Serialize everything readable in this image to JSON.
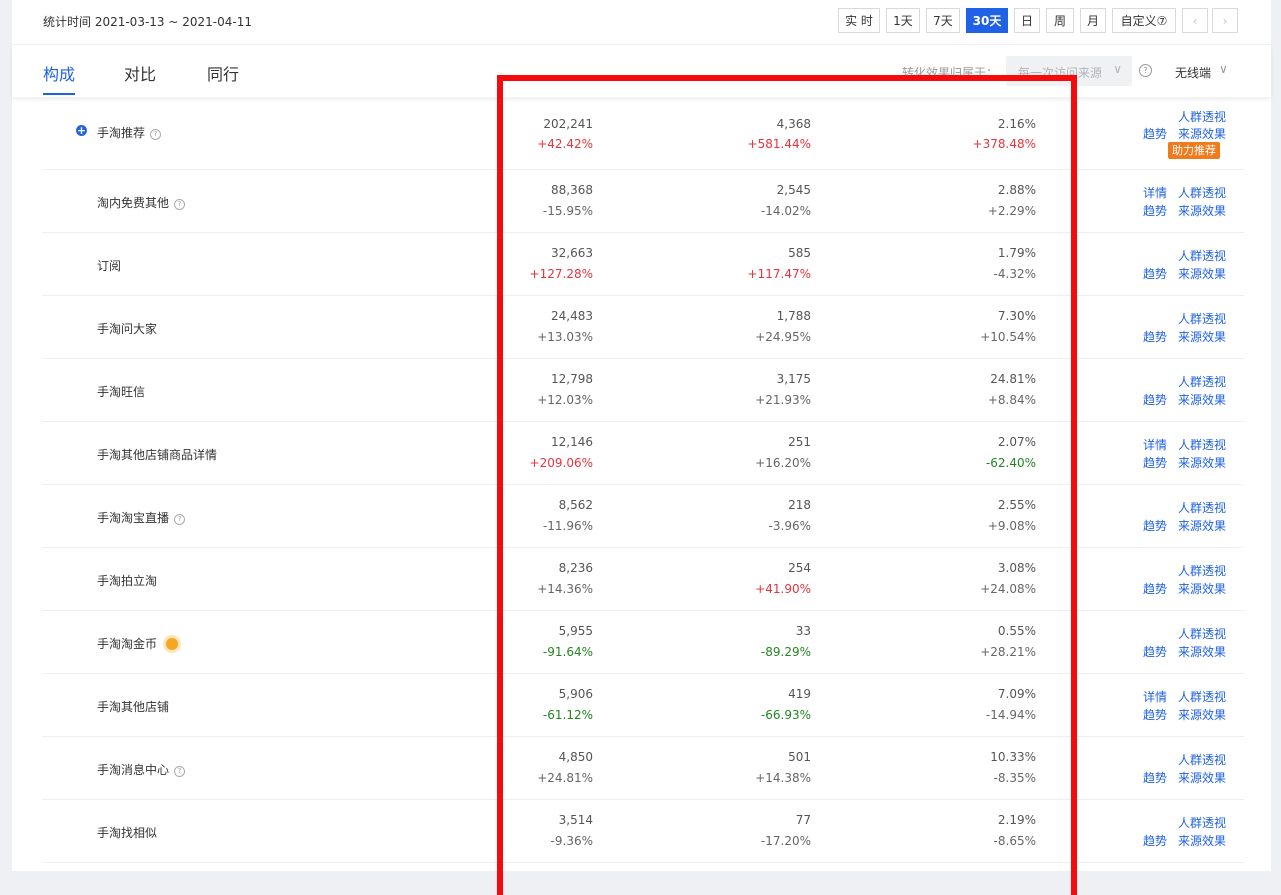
{
  "stat": {
    "label": "统计时间 2021-03-13 ~ 2021-04-11"
  },
  "range_buttons": [
    "实 时",
    "1天",
    "7天",
    "30天",
    "日",
    "周",
    "月",
    "自定义⑦"
  ],
  "tabs": [
    "构成",
    "对比",
    "同行"
  ],
  "filters": {
    "conversion_label": "转化效果归属于：",
    "source_value": "每一次访问来源",
    "device": "无线端"
  },
  "rows": [
    {
      "name": "手淘推荐",
      "help": true,
      "plus": true,
      "v1": "202,241",
      "c1": "+42.42%",
      "v2": "4,368",
      "c2": "+581.44%",
      "v3": "2.16%",
      "c3": "+378.48%",
      "links": [
        "人群透视",
        "趋势",
        "来源效果"
      ],
      "badge": "助力推荐"
    },
    {
      "name": "淘内免费其他",
      "help": true,
      "v1": "88,368",
      "c1": "-15.95%",
      "v2": "2,545",
      "c2": "-14.02%",
      "v3": "2.88%",
      "c3": "+2.29%",
      "links": [
        "详情",
        "人群透视",
        "趋势",
        "来源效果"
      ]
    },
    {
      "name": "订阅",
      "v1": "32,663",
      "c1": "+127.28%",
      "v2": "585",
      "c2": "+117.47%",
      "v3": "1.79%",
      "c3": "-4.32%",
      "links": [
        "人群透视",
        "趋势",
        "来源效果"
      ]
    },
    {
      "name": "手淘问大家",
      "v1": "24,483",
      "c1": "+13.03%",
      "v2": "1,788",
      "c2": "+24.95%",
      "v3": "7.30%",
      "c3": "+10.54%",
      "links": [
        "人群透视",
        "趋势",
        "来源效果"
      ]
    },
    {
      "name": "手淘旺信",
      "v1": "12,798",
      "c1": "+12.03%",
      "v2": "3,175",
      "c2": "+21.93%",
      "v3": "24.81%",
      "c3": "+8.84%",
      "links": [
        "人群透视",
        "趋势",
        "来源效果"
      ]
    },
    {
      "name": "手淘其他店铺商品详情",
      "v1": "12,146",
      "c1": "+209.06%",
      "v2": "251",
      "c2": "+16.20%",
      "v3": "2.07%",
      "c3": "-62.40%",
      "links": [
        "详情",
        "人群透视",
        "趋势",
        "来源效果"
      ]
    },
    {
      "name": "手淘淘宝直播",
      "help": true,
      "v1": "8,562",
      "c1": "-11.96%",
      "v2": "218",
      "c2": "-3.96%",
      "v3": "2.55%",
      "c3": "+9.08%",
      "links": [
        "人群透视",
        "趋势",
        "来源效果"
      ]
    },
    {
      "name": "手淘拍立淘",
      "v1": "8,236",
      "c1": "+14.36%",
      "v2": "254",
      "c2": "+41.90%",
      "v3": "3.08%",
      "c3": "+24.08%",
      "links": [
        "人群透视",
        "趋势",
        "来源效果"
      ]
    },
    {
      "name": "手淘淘金币",
      "coin": true,
      "v1": "5,955",
      "c1": "-91.64%",
      "v2": "33",
      "c2": "-89.29%",
      "v3": "0.55%",
      "c3": "+28.21%",
      "links": [
        "人群透视",
        "趋势",
        "来源效果"
      ]
    },
    {
      "name": "手淘其他店铺",
      "v1": "5,906",
      "c1": "-61.12%",
      "v2": "419",
      "c2": "-66.93%",
      "v3": "7.09%",
      "c3": "-14.94%",
      "links": [
        "详情",
        "人群透视",
        "趋势",
        "来源效果"
      ]
    },
    {
      "name": "手淘消息中心",
      "help": true,
      "v1": "4,850",
      "c1": "+24.81%",
      "v2": "501",
      "c2": "+14.38%",
      "v3": "10.33%",
      "c3": "-8.35%",
      "links": [
        "人群透视",
        "趋势",
        "来源效果"
      ]
    },
    {
      "name": "手淘找相似",
      "v1": "3,514",
      "c1": "-9.36%",
      "v2": "77",
      "c2": "-17.20%",
      "v3": "2.19%",
      "c3": "-8.65%",
      "links": [
        "人群透视",
        "趋势",
        "来源效果"
      ]
    }
  ],
  "colors": {
    "accent": "#2062e6",
    "up": "#e8343a",
    "down": "#22861e",
    "highlight": "#f50b0b",
    "badge": "#f07b1d"
  }
}
